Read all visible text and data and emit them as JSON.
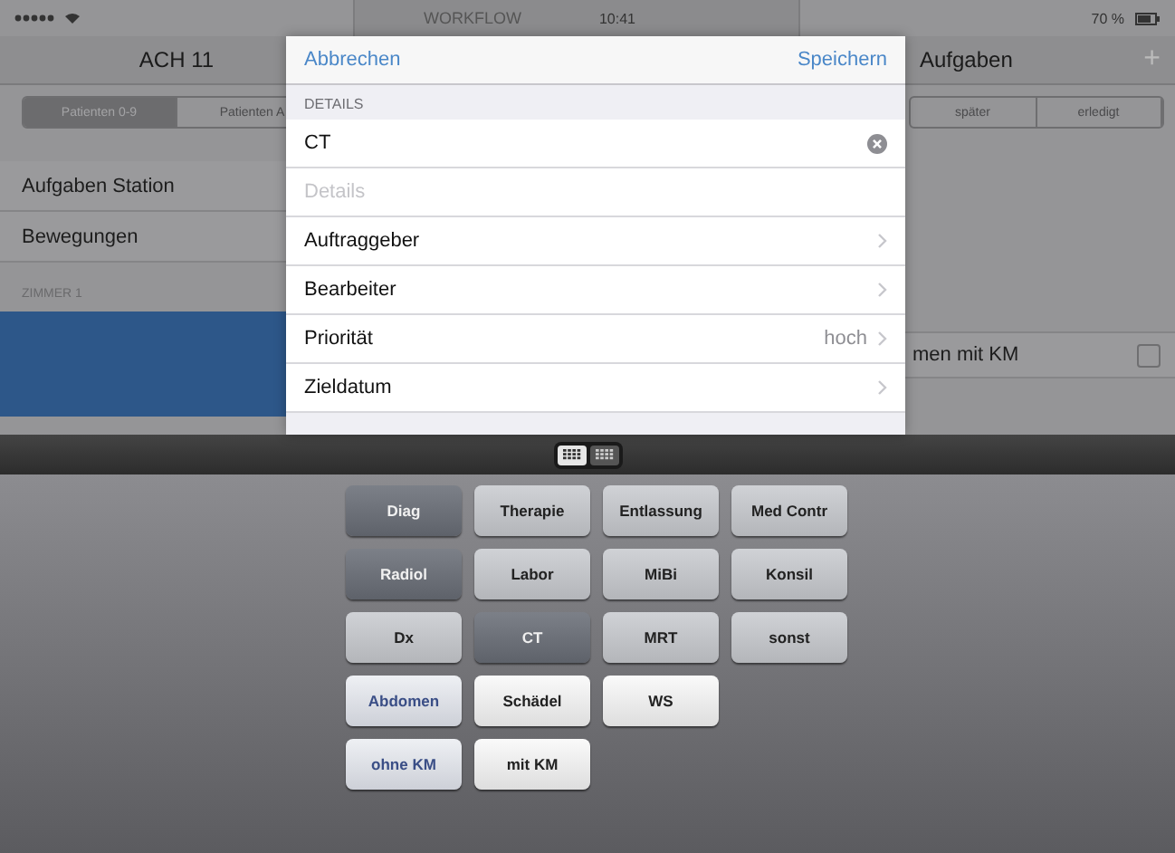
{
  "status_bar": {
    "time": "10:41",
    "battery": "70 %"
  },
  "left_panel": {
    "title": "ACH 11",
    "segments": [
      {
        "label": "Patienten 0-9",
        "selected": true
      },
      {
        "label": "Patienten A",
        "selected": false
      }
    ],
    "items": [
      "Aufgaben Station",
      "Bewegungen"
    ],
    "section": "ZIMMER 1",
    "rows": [
      {
        "selected": true
      }
    ]
  },
  "middle_panel": {
    "title": "WORKFLOW"
  },
  "right_panel": {
    "title": "Aufgaben",
    "add": "+",
    "segments": [
      {
        "label": "später",
        "selected": false
      },
      {
        "label": "erledigt",
        "selected": false
      }
    ],
    "tasks": [
      {
        "label": "men mit KM",
        "checked": false
      }
    ]
  },
  "modal": {
    "cancel": "Abbrechen",
    "save": "Speichern",
    "section": "DETAILS",
    "title_field": {
      "value": "CT"
    },
    "details_field": {
      "placeholder": "Details"
    },
    "rows": [
      {
        "label": "Auftraggeber"
      },
      {
        "label": "Bearbeiter"
      },
      {
        "label": "Priorität",
        "value": "hoch"
      },
      {
        "label": "Zieldatum"
      }
    ]
  },
  "keyboard": {
    "modes": [
      {
        "selected": true
      },
      {
        "selected": false
      }
    ],
    "rows": [
      [
        {
          "label": "Diag",
          "kind": "category",
          "selected": true
        },
        {
          "label": "Therapie",
          "kind": "category",
          "selected": false
        },
        {
          "label": "Entlassung",
          "kind": "category",
          "selected": false
        },
        {
          "label": "Med Contr",
          "kind": "category",
          "selected": false
        }
      ],
      [
        {
          "label": "Radiol",
          "kind": "category",
          "selected": true
        },
        {
          "label": "Labor",
          "kind": "category",
          "selected": false
        },
        {
          "label": "MiBi",
          "kind": "category",
          "selected": false
        },
        {
          "label": "Konsil",
          "kind": "category",
          "selected": false
        }
      ],
      [
        {
          "label": "Dx",
          "kind": "category",
          "selected": false
        },
        {
          "label": "CT",
          "kind": "category",
          "selected": true
        },
        {
          "label": "MRT",
          "kind": "category",
          "selected": false
        },
        {
          "label": "sonst",
          "kind": "category",
          "selected": false
        }
      ],
      [
        {
          "label": "Abdomen",
          "kind": "option",
          "selected": true
        },
        {
          "label": "Schädel",
          "kind": "option",
          "selected": false
        },
        {
          "label": "WS",
          "kind": "option",
          "selected": false
        }
      ],
      [
        {
          "label": "ohne KM",
          "kind": "option",
          "selected": true
        },
        {
          "label": "mit KM",
          "kind": "option",
          "selected": false
        }
      ]
    ]
  }
}
